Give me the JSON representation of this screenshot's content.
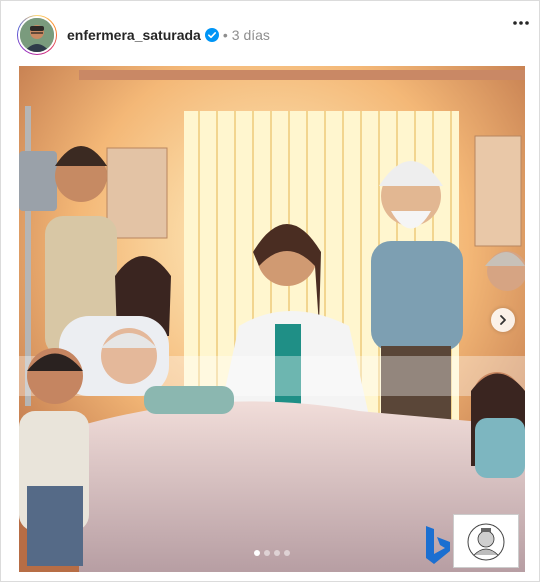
{
  "post": {
    "username": "enfermera_saturada",
    "separator": "•",
    "time_ago": "3 días",
    "verified_icon": "verified-badge-icon",
    "more_icon": "more-horizontal-icon"
  },
  "carousel": {
    "total_slides": 4,
    "active_slide": 1,
    "next_icon": "chevron-right-icon"
  },
  "colors": {
    "verified": "#0095f6",
    "accent_warm": "#f3c08a",
    "bing_blue": "#1b6fd1"
  }
}
